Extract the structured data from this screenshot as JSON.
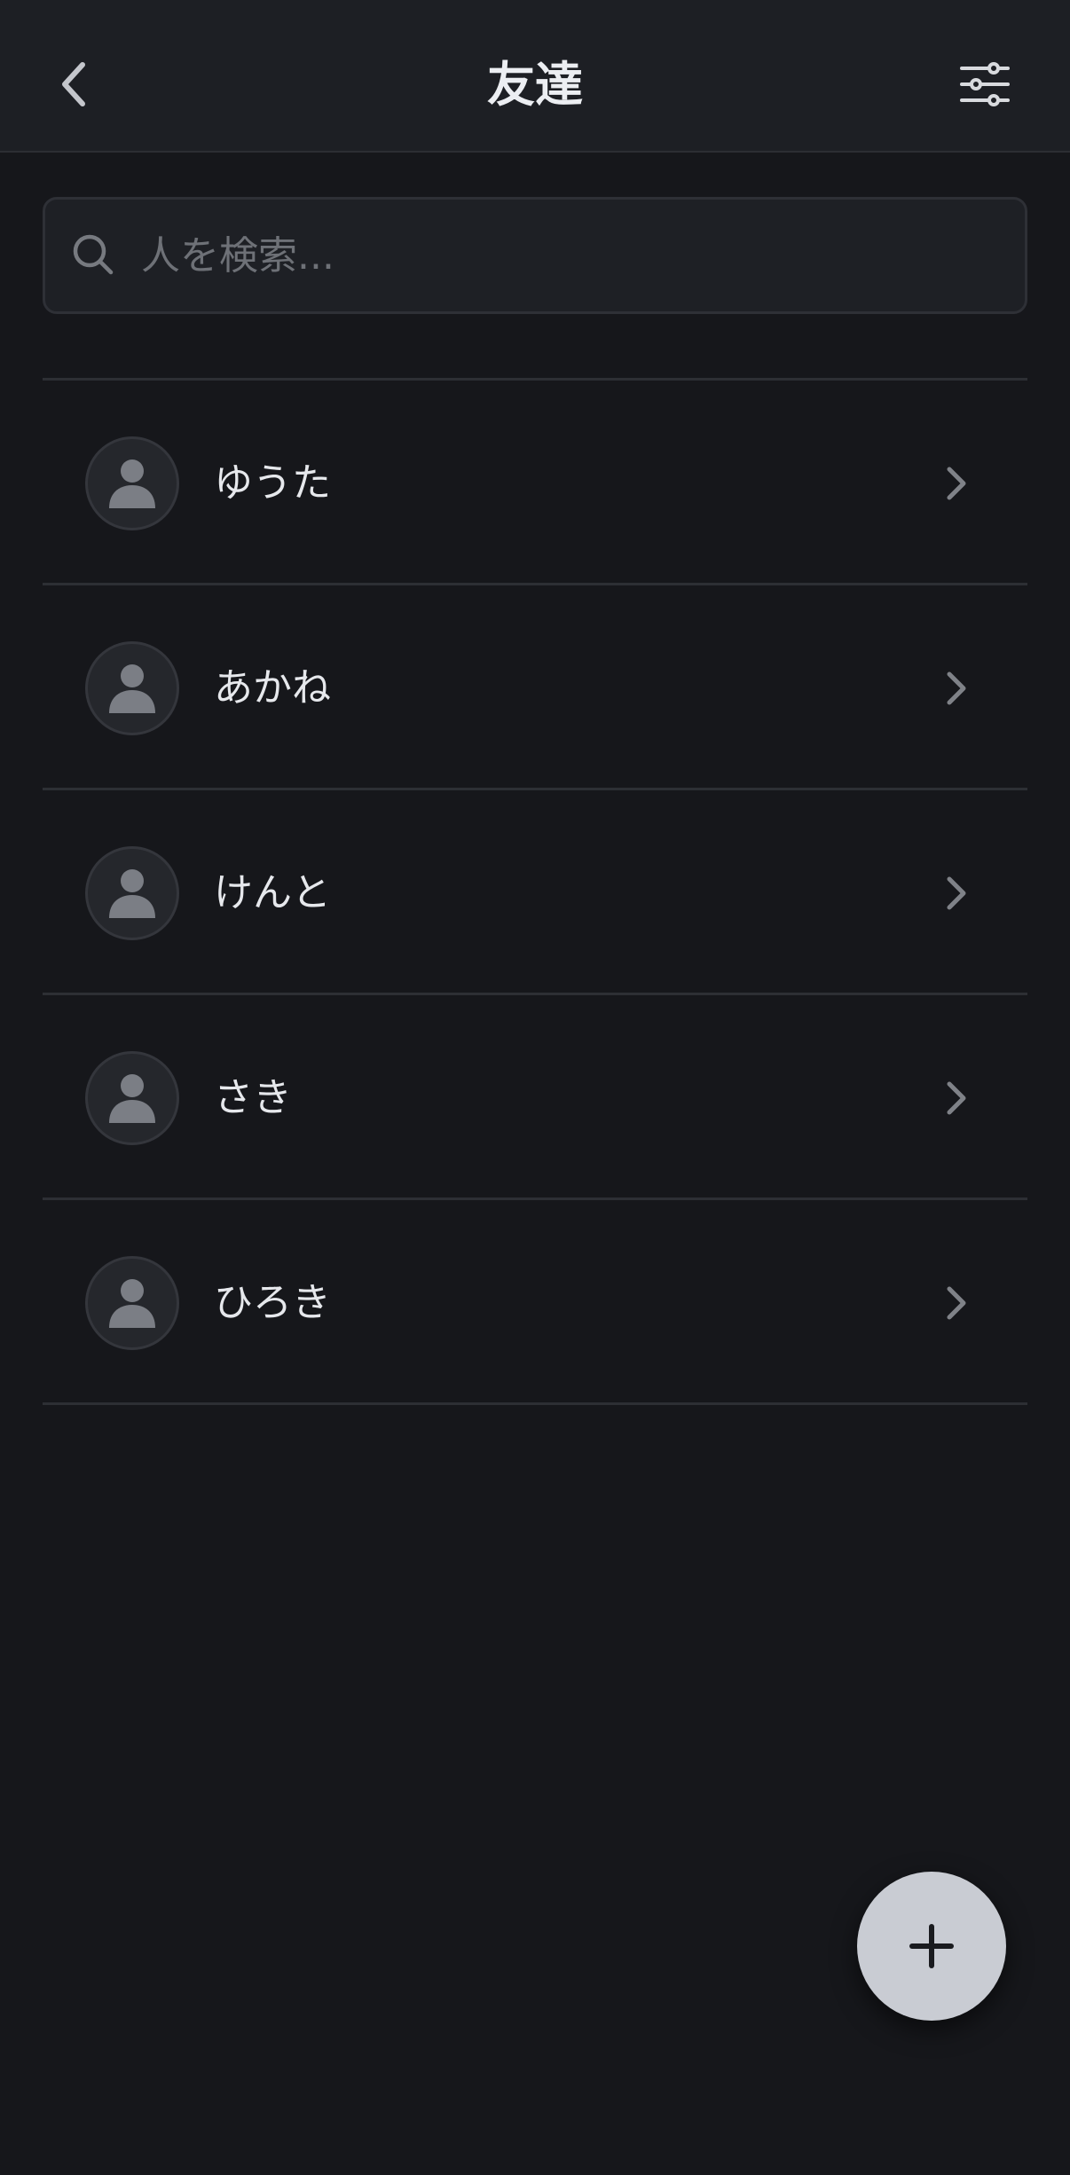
{
  "header": {
    "title": "友達",
    "back_icon": "chevron-left-icon",
    "filter_icon": "sliders-icon"
  },
  "search": {
    "placeholder": "人を検索...",
    "value": "",
    "icon": "search-icon"
  },
  "friends": [
    {
      "name": "ゆうた",
      "avatar_icon": "person-icon"
    },
    {
      "name": "あかね",
      "avatar_icon": "person-icon"
    },
    {
      "name": "けんと",
      "avatar_icon": "person-icon"
    },
    {
      "name": "さき",
      "avatar_icon": "person-icon"
    },
    {
      "name": "ひろき",
      "avatar_icon": "person-icon"
    }
  ],
  "fab": {
    "icon": "plus-icon"
  },
  "colors": {
    "background": "#16171b",
    "header": "#1d1f24",
    "divider": "#2d2f34",
    "text_primary": "#e6e8ec",
    "text_muted": "#6e7177",
    "fab_background": "#c9ccd3",
    "fab_icon": "#1a1b1f"
  }
}
